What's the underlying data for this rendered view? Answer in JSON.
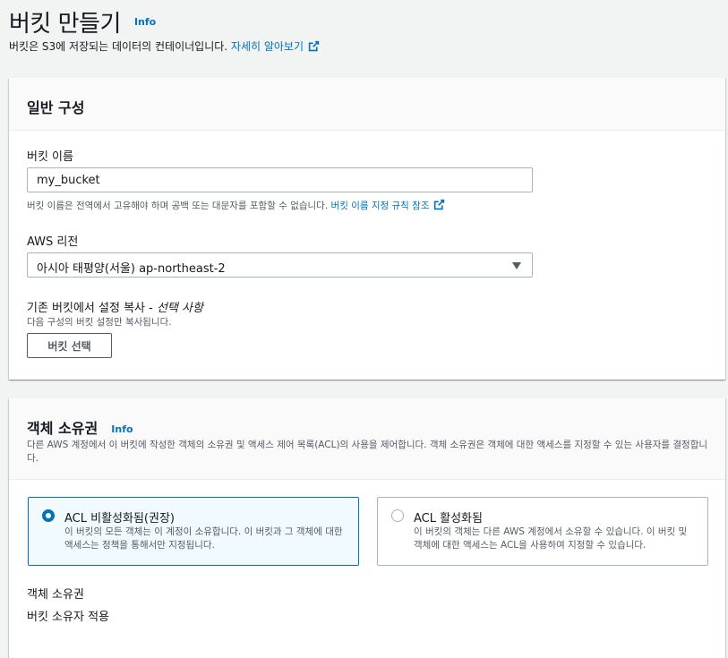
{
  "header": {
    "title": "버킷 만들기",
    "info": "Info",
    "description": "버킷은 S3에 저장되는 데이터의 컨테이너입니다.",
    "learn_more": "자세히 알아보기"
  },
  "general": {
    "title": "일반 구성",
    "bucket_name_label": "버킷 이름",
    "bucket_name_value": "my_bucket",
    "bucket_name_hint": "버킷 이름은 전역에서 고유해야 하며 공백 또는 대문자를 포함할 수 없습니다.",
    "bucket_name_rules_link": "버킷 이름 지정 규칙 참조",
    "region_label": "AWS 리전",
    "region_value": "아시아 태평양(서울) ap-northeast-2",
    "copy_label": "기존 버킷에서 설정 복사 - ",
    "copy_optional": "선택 사항",
    "copy_desc": "다음 구성의 버킷 설정만 복사됩니다.",
    "choose_bucket_button": "버킷 선택"
  },
  "ownership": {
    "title": "객체 소유권",
    "info": "Info",
    "description": "다른 AWS 계정에서 이 버킷에 작성한 객체의 소유권 및 액세스 제어 목록(ACL)의 사용을 제어합니다. 객체 소유권은 객체에 대한 액세스를 지정할 수 있는 사용자를 결정합니다.",
    "options": [
      {
        "label": "ACL 비활성화됨(권장)",
        "desc": "이 버킷의 모든 객체는 이 계정이 소유합니다. 이 버킷과 그 객체에 대한 액세스는 정책을 통해서만 지정됩니다.",
        "selected": true
      },
      {
        "label": "ACL 활성화됨",
        "desc": "이 버킷의 객체는 다른 AWS 계정에서 소유할 수 있습니다. 이 버킷 및 객체에 대한 액세스는 ACL을 사용하여 지정할 수 있습니다.",
        "selected": false
      }
    ],
    "owner_label": "객체 소유권",
    "owner_value": "버킷 소유자 적용"
  },
  "colors": {
    "link": "#0073bb",
    "selected_border": "#0073bb",
    "selected_bg": "#f1faff"
  }
}
